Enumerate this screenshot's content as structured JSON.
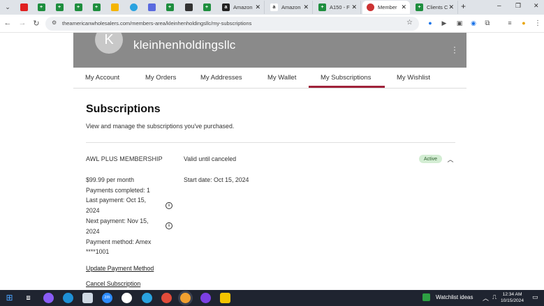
{
  "browser": {
    "tabs": [
      {
        "label": "Amazon"
      },
      {
        "label": "Amazon"
      },
      {
        "label": "A150 - F"
      },
      {
        "label": "Member"
      },
      {
        "label": "Clients C"
      }
    ],
    "url": "theamericanwholesalers.com/members-area/kleinhenholdingsllc/my-subscriptions"
  },
  "profile": {
    "avatar_letter": "K",
    "username": "kleinhenholdingsllc"
  },
  "nav": {
    "items": [
      {
        "label": "My Account"
      },
      {
        "label": "My Orders"
      },
      {
        "label": "My Addresses"
      },
      {
        "label": "My Wallet"
      },
      {
        "label": "My Subscriptions"
      },
      {
        "label": "My Wishlist"
      }
    ],
    "active": "My Subscriptions"
  },
  "page": {
    "title": "Subscriptions",
    "subtitle": "View and manage the subscriptions you've purchased."
  },
  "subscription": {
    "plan": "AWL PLUS MEMBERSHIP",
    "validity": "Valid until canceled",
    "status": "Active",
    "price": "$99.99 per month",
    "payments_completed": "Payments completed: 1",
    "last_payment_line1": "Last payment: Oct 15,",
    "last_payment_line2": "2024",
    "next_payment_line1": "Next payment: Nov 15,",
    "next_payment_line2": "2024",
    "payment_method_line1": "Payment method: Amex",
    "payment_method_line2": "****1001",
    "start_date": "Start date: Oct 15, 2024",
    "update_link": "Update Payment Method",
    "cancel_link": "Cancel Subscription"
  },
  "taskbar": {
    "watchlist": "Watchlist ideas",
    "time": "12:34 AM",
    "date": "10/15/2024"
  },
  "colors": {
    "accent": "#a0223a",
    "banner": "#8a8a8a",
    "badge": "#d3edd3",
    "taskbar": "#1f2430"
  }
}
